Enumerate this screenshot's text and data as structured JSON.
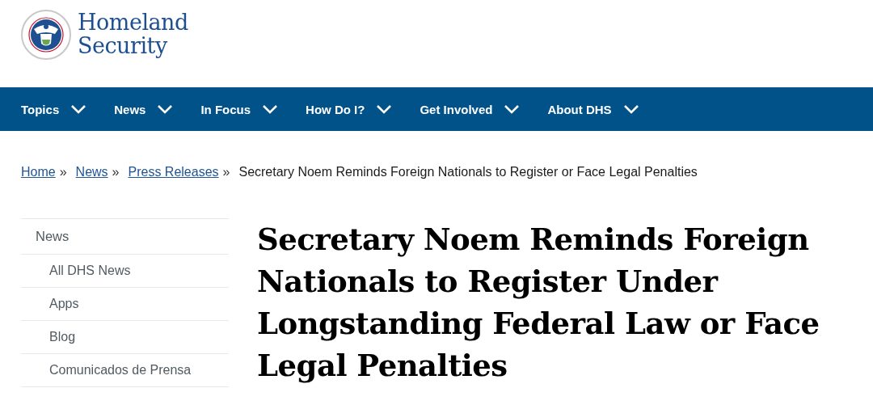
{
  "header": {
    "logo_line_1": "Homeland",
    "logo_line_2": "Security"
  },
  "nav": [
    {
      "label": "Topics",
      "expanded": false
    },
    {
      "label": "News",
      "expanded": false
    },
    {
      "label": "In Focus",
      "expanded": false
    },
    {
      "label": "How Do I?",
      "expanded": false
    },
    {
      "label": "Get Involved",
      "expanded": false
    },
    {
      "label": "About DHS",
      "expanded": false
    }
  ],
  "breadcrumb": {
    "links": [
      "Home",
      "News",
      "Press Releases"
    ],
    "separator": "»",
    "current": "Secretary Noem Reminds Foreign Nationals to Register or Face Legal Penalties"
  },
  "sidebar": {
    "heading": "News",
    "items": [
      "All DHS News",
      "Apps",
      "Blog",
      "Comunicados de Prensa"
    ]
  },
  "article": {
    "title": "Secretary Noem Reminds Foreign Nationals to Register Under Longstanding Federal Law or Face Legal Penalties"
  }
}
